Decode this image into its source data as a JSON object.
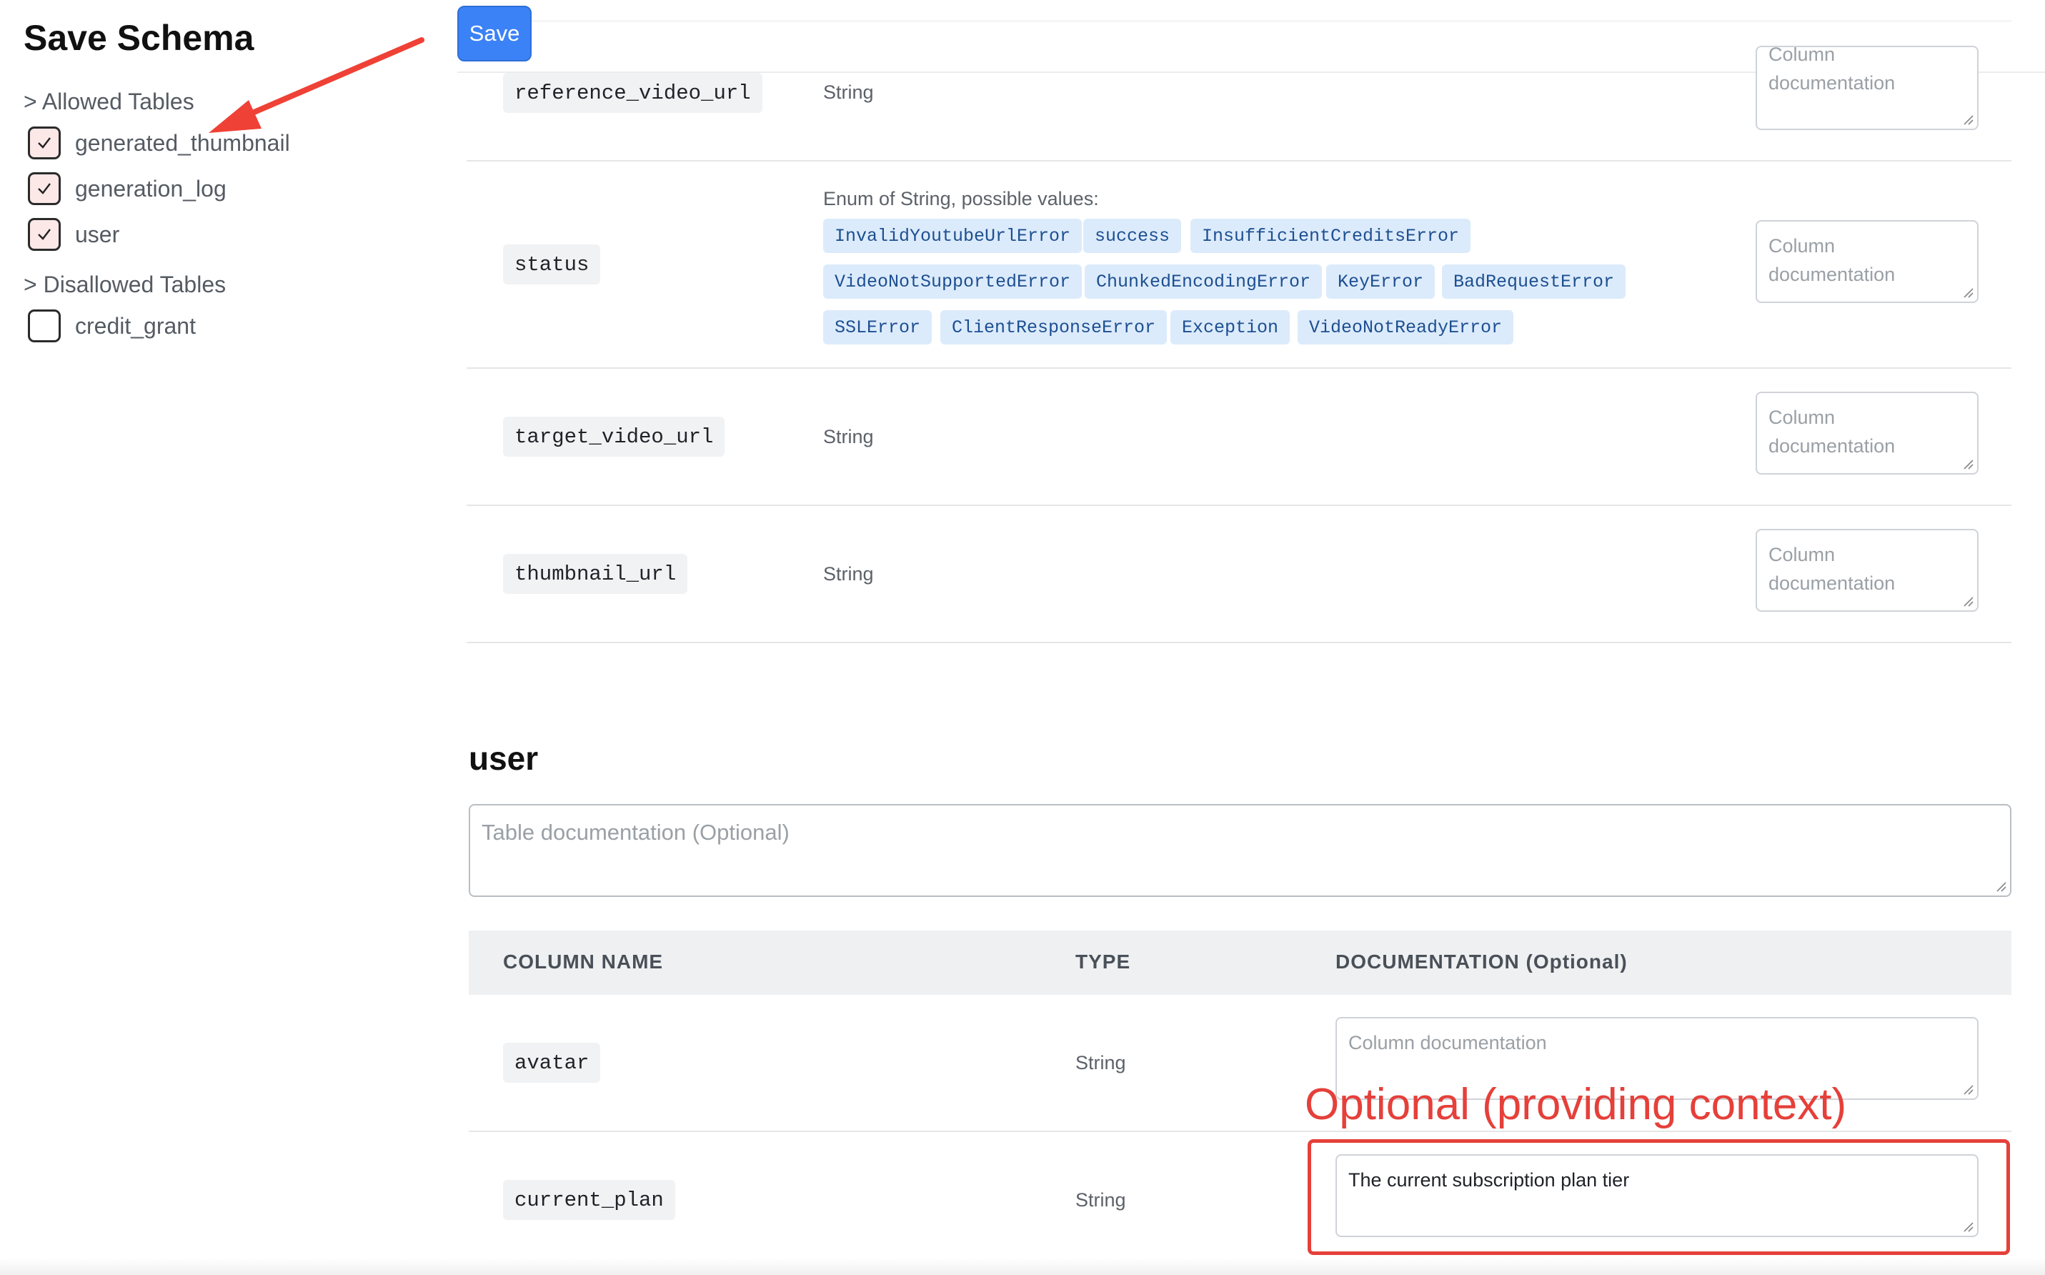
{
  "sidebar": {
    "title": "Save Schema",
    "allowed_heading": "> Allowed Tables",
    "allowed": [
      {
        "name": "generated_thumbnail",
        "checked": true
      },
      {
        "name": "generation_log",
        "checked": true
      },
      {
        "name": "user",
        "checked": true
      }
    ],
    "disallowed_heading": "> Disallowed Tables",
    "disallowed": [
      {
        "name": "credit_grant",
        "checked": false
      }
    ]
  },
  "toolbar": {
    "save_label": "Save"
  },
  "upper_table": {
    "rows": [
      {
        "name": "reference_video_url",
        "type": "String",
        "doc_placeholder": "Column documentation"
      },
      {
        "name": "status",
        "type_heading": "Enum of String, possible values:",
        "enum_values": [
          "InvalidYoutubeUrlError",
          "success",
          "InsufficientCreditsError",
          "VideoNotSupportedError",
          "ChunkedEncodingError",
          "KeyError",
          "BadRequestError",
          "SSLError",
          "ClientResponseError",
          "Exception",
          "VideoNotReadyError"
        ],
        "doc_placeholder": "Column documentation"
      },
      {
        "name": "target_video_url",
        "type": "String",
        "doc_placeholder": "Column documentation"
      },
      {
        "name": "thumbnail_url",
        "type": "String",
        "doc_placeholder": "Column documentation"
      }
    ]
  },
  "user_table": {
    "title": "user",
    "table_doc_placeholder": "Table documentation (Optional)",
    "headers": {
      "name": "COLUMN NAME",
      "type": "TYPE",
      "doc": "DOCUMENTATION (Optional)"
    },
    "rows": [
      {
        "name": "avatar",
        "type": "String",
        "doc_placeholder": "Column documentation",
        "doc_value": ""
      },
      {
        "name": "current_plan",
        "type": "String",
        "doc_placeholder": "Column documentation",
        "doc_value": "The current subscription plan tier"
      }
    ]
  },
  "annotation": {
    "label": "Optional (providing context)",
    "color": "#e5403a"
  },
  "colors": {
    "accent": "#3b82f6",
    "enum_bg": "#dcebfb",
    "enum_text": "#1d4f91",
    "checkbox_fill": "#fde8e8"
  }
}
